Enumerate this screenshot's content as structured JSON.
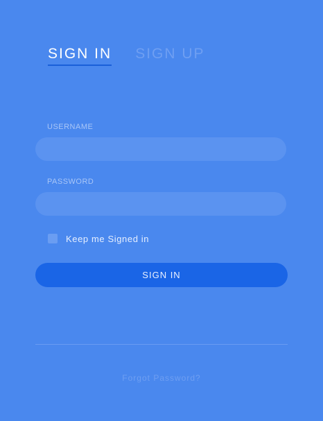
{
  "tabs": {
    "signin": "SIGN IN",
    "signup": "SIGN UP"
  },
  "form": {
    "username_label": "USERNAME",
    "username_value": "",
    "password_label": "PASSWORD",
    "password_value": "",
    "keep_signed_in": "Keep me Signed in",
    "submit_label": "SIGN IN"
  },
  "footer": {
    "forgot": "Forgot Password?"
  },
  "colors": {
    "background": "#4a88ee",
    "button": "#1a65e6",
    "field": "#5b93f0",
    "tab_underline": "#1a5fd8"
  }
}
